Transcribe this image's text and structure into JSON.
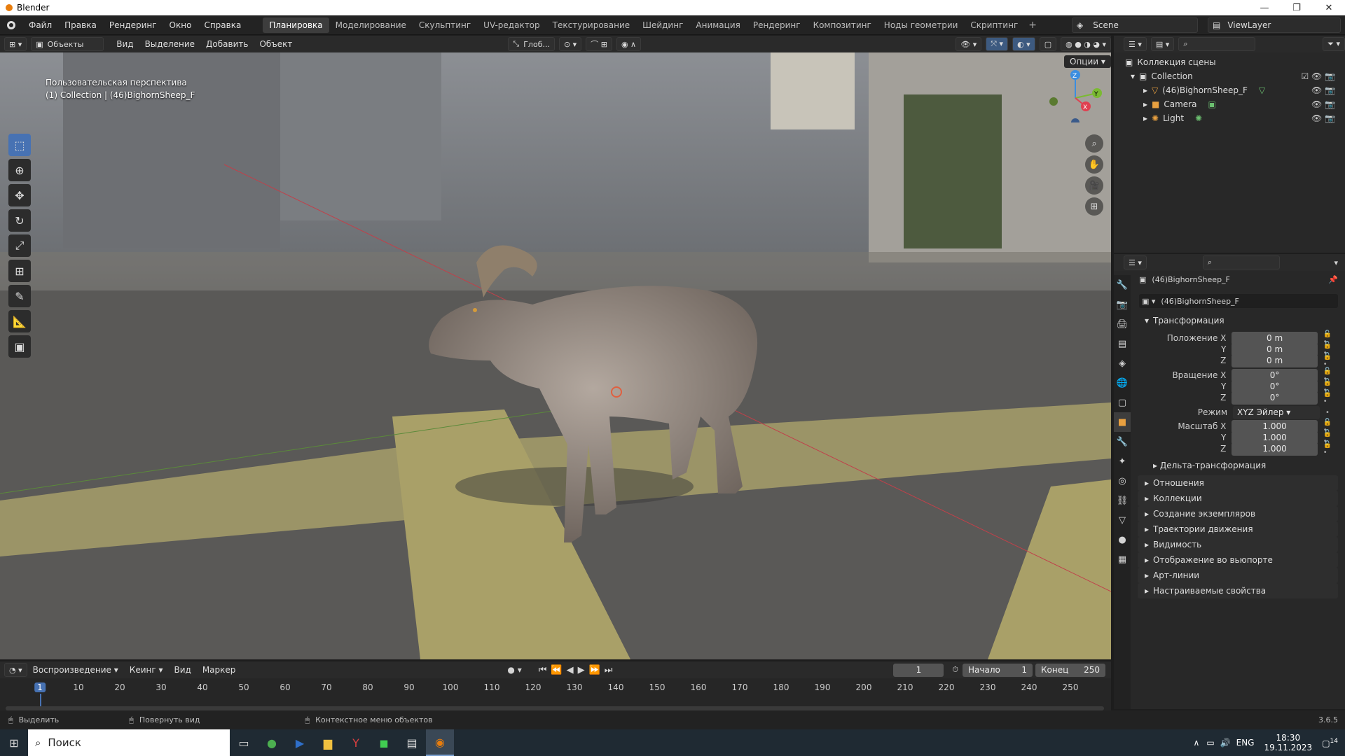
{
  "window": {
    "title": "Blender"
  },
  "menu": [
    "Файл",
    "Правка",
    "Рендеринг",
    "Окно",
    "Справка"
  ],
  "workspaces": [
    "Планировка",
    "Моделирование",
    "Скульптинг",
    "UV-редактор",
    "Текстурирование",
    "Шейдинг",
    "Анимация",
    "Рендеринг",
    "Композитинг",
    "Ноды геометрии",
    "Скриптинг"
  ],
  "active_workspace": "Планировка",
  "scene": {
    "name": "Scene",
    "view_layer": "ViewLayer"
  },
  "viewport_header": {
    "mode": "Объекты",
    "menus": [
      "Вид",
      "Выделение",
      "Добавить",
      "Объект"
    ],
    "transform_orientation": "Глоб...",
    "options": "Опции"
  },
  "viewport": {
    "perspective_label": "Пользовательская перспектива",
    "collection_label": "(1) Collection | (46)BighornSheep_F",
    "gizmo_axes": {
      "x": "X",
      "y": "Y",
      "z": "Z"
    }
  },
  "outliner": {
    "root": "Коллекция сцены",
    "collection": "Collection",
    "items": [
      "(46)BighornSheep_F",
      "Camera",
      "Light"
    ]
  },
  "properties": {
    "object_name": "(46)BighornSheep_F",
    "object_name_field": "(46)BighornSheep_F",
    "transform_header": "Трансформация",
    "location_label": "Положение X",
    "rotation_label": "Вращение X",
    "scale_label": "Масштаб X",
    "y_label": "Y",
    "z_label": "Z",
    "mode_label": "Режим",
    "location": [
      "0 m",
      "0 m",
      "0 m"
    ],
    "rotation": [
      "0°",
      "0°",
      "0°"
    ],
    "mode": "XYZ Эйлер",
    "scale": [
      "1.000",
      "1.000",
      "1.000"
    ],
    "delta": "Дельта-трансформация",
    "sections": [
      "Отношения",
      "Коллекции",
      "Создание экземпляров",
      "Траектории движения",
      "Видимость",
      "Отображение во вьюпорте",
      "Арт-линии",
      "Настраиваемые свойства"
    ]
  },
  "timeline": {
    "menus": [
      "Воспроизведение",
      "Кеинг",
      "Вид",
      "Маркер"
    ],
    "current_frame": "1",
    "start_label": "Начало",
    "start": "1",
    "end_label": "Конец",
    "end": "250",
    "ticks": [
      "1",
      "10",
      "20",
      "30",
      "40",
      "50",
      "60",
      "70",
      "80",
      "90",
      "100",
      "110",
      "120",
      "130",
      "140",
      "150",
      "160",
      "170",
      "180",
      "190",
      "200",
      "210",
      "220",
      "230",
      "240",
      "250"
    ]
  },
  "status": {
    "select": "Выделить",
    "rotate": "Повернуть вид",
    "context": "Контекстное меню объектов",
    "version": "3.6.5"
  },
  "taskbar": {
    "search": "Поиск",
    "lang": "ENG",
    "time": "18:30",
    "date": "19.11.2023",
    "notif": "14"
  }
}
